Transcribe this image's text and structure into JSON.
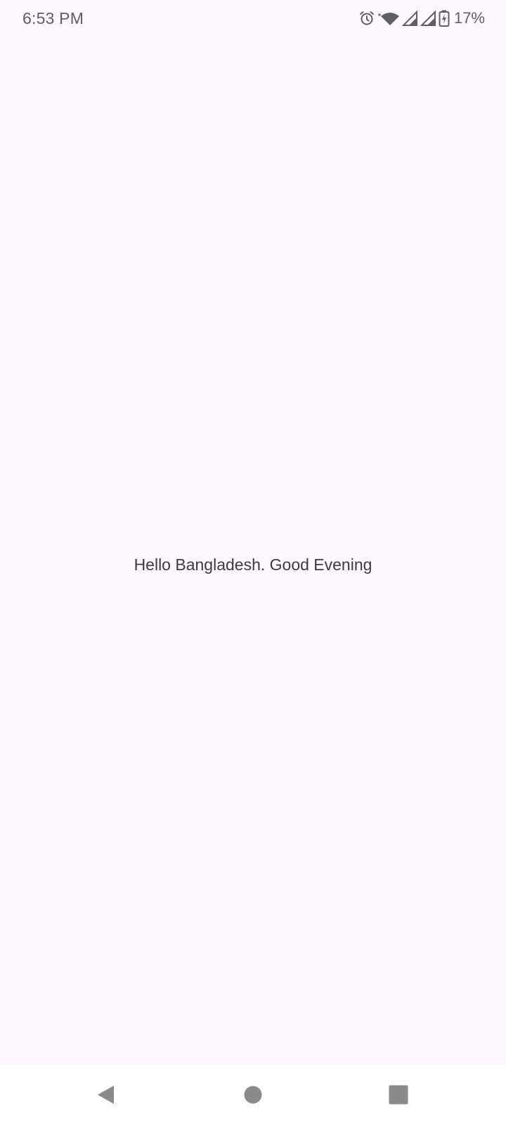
{
  "status_bar": {
    "time": "6:53 PM",
    "battery_percent": "17%",
    "icons": [
      "alarm-icon",
      "wifi-icon",
      "signal-icon",
      "signal-icon",
      "battery-charging-icon"
    ],
    "text_color": "#5f5f64"
  },
  "main": {
    "greeting": "Hello Bangladesh. Good Evening"
  },
  "nav_bar": {
    "buttons": [
      "back-icon",
      "home-icon",
      "recents-icon"
    ],
    "icon_color": "#8a8a8a"
  },
  "colors": {
    "background": "#fdf7fe",
    "nav_background": "#ffffff",
    "text": "#3d3a42"
  }
}
